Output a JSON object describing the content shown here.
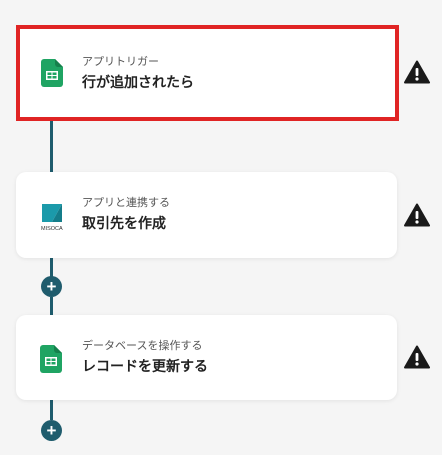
{
  "flow": {
    "steps": [
      {
        "subtitle": "アプリトリガー",
        "title": "行が追加されたら",
        "icon": "google-sheets-icon",
        "selected": true,
        "warning": true
      },
      {
        "subtitle": "アプリと連携する",
        "title": "取引先を作成",
        "icon": "misoca-icon",
        "icon_caption": "MISOCA",
        "selected": false,
        "warning": true
      },
      {
        "subtitle": "データベースを操作する",
        "title": "レコードを更新する",
        "icon": "google-sheets-icon",
        "selected": false,
        "warning": true
      }
    ],
    "add_label": "+",
    "warning_icon": "warning-icon"
  },
  "colors": {
    "connector": "#1f5c6d",
    "selected_border": "#e02424",
    "sheets_green": "#1fa463",
    "misoca_teal": "#1b9aaa"
  }
}
